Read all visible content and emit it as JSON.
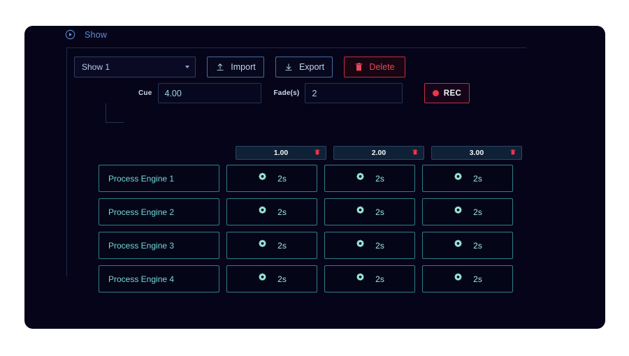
{
  "header": {
    "icon": "play-circle-icon",
    "title": "Show"
  },
  "toolbar": {
    "show_select": {
      "value": "Show 1",
      "caret_icon": "chevron-down-icon"
    },
    "import_button": {
      "label": "Import",
      "icon": "upload-icon"
    },
    "export_button": {
      "label": "Export",
      "icon": "download-icon"
    },
    "delete_button": {
      "label": "Delete",
      "icon": "trash-icon"
    }
  },
  "cue_controls": {
    "cue_label": "Cue",
    "cue_value": "4.00",
    "fade_label": "Fade(s)",
    "fade_value": "2",
    "rec_button": {
      "label": "REC",
      "icon": "record-dot-icon"
    }
  },
  "cue_columns": [
    {
      "label": "1.00",
      "delete_icon": "trash-icon"
    },
    {
      "label": "2.00",
      "delete_icon": "trash-icon"
    },
    {
      "label": "3.00",
      "delete_icon": "trash-icon"
    }
  ],
  "rows": [
    {
      "engine": "Process Engine 1",
      "cells": [
        {
          "icon": "gear-icon",
          "value": "2s"
        },
        {
          "icon": "gear-icon",
          "value": "2s"
        },
        {
          "icon": "gear-icon",
          "value": "2s"
        }
      ]
    },
    {
      "engine": "Process Engine 2",
      "cells": [
        {
          "icon": "gear-icon",
          "value": "2s"
        },
        {
          "icon": "gear-icon",
          "value": "2s"
        },
        {
          "icon": "gear-icon",
          "value": "2s"
        }
      ]
    },
    {
      "engine": "Process Engine 3",
      "cells": [
        {
          "icon": "gear-icon",
          "value": "2s"
        },
        {
          "icon": "gear-icon",
          "value": "2s"
        },
        {
          "icon": "gear-icon",
          "value": "2s"
        }
      ]
    },
    {
      "engine": "Process Engine 4",
      "cells": [
        {
          "icon": "gear-icon",
          "value": "2s"
        },
        {
          "icon": "gear-icon",
          "value": "2s"
        },
        {
          "icon": "gear-icon",
          "value": "2s"
        }
      ]
    }
  ],
  "colors": {
    "page_background": "#ffffff",
    "panel_background": "#060419",
    "accent_teal": "#2f7f84",
    "accent_cyan_text": "#74d7d7",
    "accent_blue": "#3f6f9e",
    "accent_red": "#e4485a",
    "header_blue": "#5b8fd6",
    "value_mint": "#9ee8d8"
  }
}
